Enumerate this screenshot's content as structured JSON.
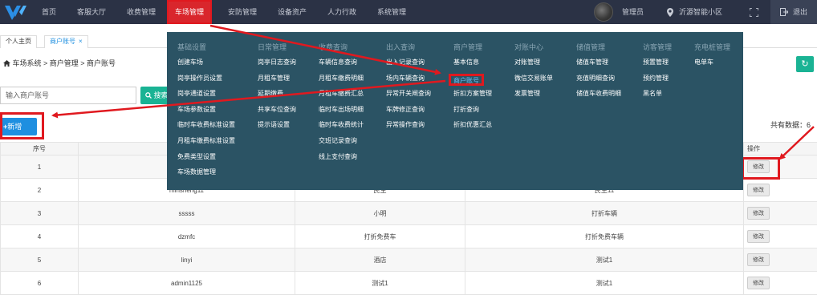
{
  "nav": {
    "items": [
      {
        "label": "首页"
      },
      {
        "label": "客服大厅"
      },
      {
        "label": "收费管理"
      },
      {
        "label": "车场管理"
      },
      {
        "label": "安防管理"
      },
      {
        "label": "设备资产"
      },
      {
        "label": "人力行政"
      },
      {
        "label": "系统管理"
      }
    ],
    "user": "管理员",
    "location": "沂源智能小区",
    "logout": "退出"
  },
  "tabs": [
    {
      "label": "个人主页"
    },
    {
      "label": "商户账号",
      "close": "×"
    }
  ],
  "breadcrumb": "车场系统 > 商户管理 > 商户账号",
  "search": {
    "placeholder": "输入商户账号",
    "button": "搜索"
  },
  "add_button": "新增",
  "total": "共有数据：6",
  "table": {
    "headers": [
      "序号",
      "",
      "",
      "",
      "操作"
    ],
    "edit_label": "修改",
    "rows": [
      {
        "no": "1",
        "account": "",
        "name": "",
        "discount": ""
      },
      {
        "no": "2",
        "account": "minsheng11",
        "name": "民生",
        "discount": "民生11"
      },
      {
        "no": "3",
        "account": "sssss",
        "name": "小明",
        "discount": "打折车辆"
      },
      {
        "no": "4",
        "account": "dzmfc",
        "name": "打折免费车",
        "discount": "打折免费车辆"
      },
      {
        "no": "5",
        "account": "linyi",
        "name": "酒店",
        "discount": "测试1"
      },
      {
        "no": "6",
        "account": "admin1125",
        "name": "测试1",
        "discount": "测试1"
      }
    ]
  },
  "menu": {
    "columns": [
      {
        "title": "基础设置",
        "items": [
          "创建车场",
          "岗亭操作员设置",
          "岗亭通道设置",
          "车场参数设置",
          "临时车收费标准设置",
          "月租车缴费标准设置",
          "免费类型设置",
          "车场数据管理"
        ]
      },
      {
        "title": "日常管理",
        "items": [
          "岗亭日志查询",
          "月租车管理",
          "延期缴费",
          "共享车位查询",
          "提示语设置"
        ]
      },
      {
        "title": "收费查询",
        "items": [
          "车辆信息查询",
          "月租车缴费明细",
          "月租车缴费汇总",
          "临时车出场明细",
          "临时车收费统计",
          "交班记录查询",
          "线上支付查询"
        ]
      },
      {
        "title": "出入查询",
        "items": [
          "出入记录查询",
          "场内车辆查询",
          "异常开关闸查询",
          "车牌修正查询",
          "异常操作查询"
        ]
      },
      {
        "title": "商户管理",
        "items": [
          "基本信息",
          "商户账号",
          "折扣方案管理",
          "打折查询",
          "折扣优惠汇总"
        ]
      },
      {
        "title": "对账中心",
        "items": [
          "对账管理",
          "微信交易账单",
          "发票管理"
        ]
      },
      {
        "title": "储值管理",
        "items": [
          "储值车管理",
          "充值明细查询",
          "储值车收费明细"
        ]
      },
      {
        "title": "访客管理",
        "items": [
          "预置管理",
          "预约管理",
          "黑名单"
        ]
      },
      {
        "title": "充电桩管理",
        "items": [
          "电单车"
        ]
      }
    ]
  },
  "colors": {
    "topbar": "#2b3245",
    "menu": "#2b5364",
    "highlight": "#e0191f",
    "primary": "#1e8fe0",
    "success": "#1ab394"
  },
  "icons": {
    "home": "home-icon",
    "pin": "location-pin-icon",
    "fullscreen": "fullscreen-icon",
    "logout": "logout-icon",
    "plus": "plus-icon",
    "search": "search-icon",
    "refresh": "refresh-icon"
  }
}
